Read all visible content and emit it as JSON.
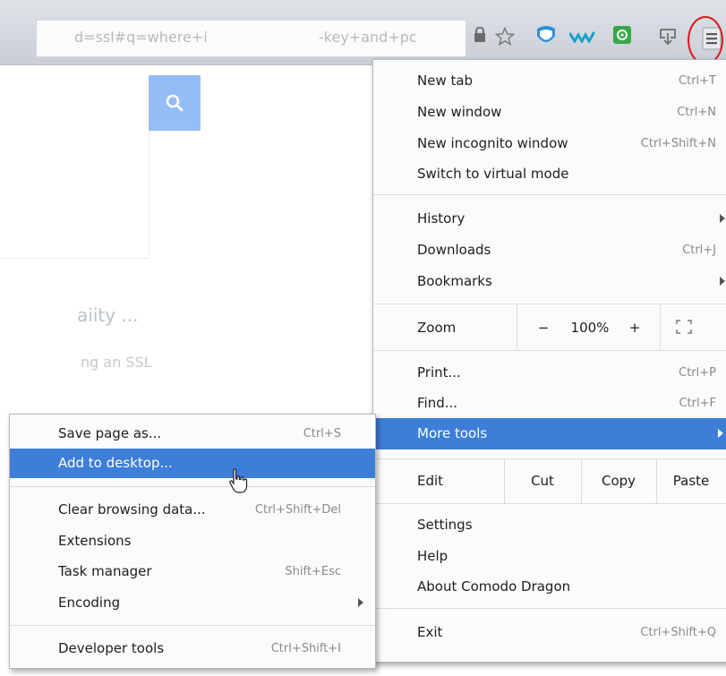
{
  "toolbar": {
    "url_left": "d=ssl#q=where+i",
    "url_right": "-key+and+pc",
    "icons": [
      "lock-icon",
      "star-icon",
      "comodo-shield-icon",
      "extension-wave-icon",
      "extension-green-icon",
      "download-icon",
      "menu-icon"
    ],
    "highlight_color": "#e4141c"
  },
  "page": {
    "faded_text_1": "aiity ...",
    "faded_text_2": "ng an SSL"
  },
  "main_menu": {
    "new_tab": {
      "label": "New tab",
      "shortcut": "Ctrl+T"
    },
    "new_window": {
      "label": "New window",
      "shortcut": "Ctrl+N"
    },
    "new_incognito": {
      "label": "New incognito window",
      "shortcut": "Ctrl+Shift+N"
    },
    "virtual_mode": {
      "label": "Switch to virtual mode"
    },
    "history": {
      "label": "History"
    },
    "downloads": {
      "label": "Downloads",
      "shortcut": "Ctrl+J"
    },
    "bookmarks": {
      "label": "Bookmarks"
    },
    "zoom": {
      "label": "Zoom",
      "minus": "−",
      "value": "100%",
      "plus": "+"
    },
    "print": {
      "label": "Print...",
      "shortcut": "Ctrl+P"
    },
    "find": {
      "label": "Find...",
      "shortcut": "Ctrl+F"
    },
    "more_tools": {
      "label": "More tools"
    },
    "edit": {
      "label": "Edit",
      "cut": "Cut",
      "copy": "Copy",
      "paste": "Paste"
    },
    "settings": {
      "label": "Settings"
    },
    "help": {
      "label": "Help"
    },
    "about": {
      "label": "About Comodo Dragon"
    },
    "exit": {
      "label": "Exit",
      "shortcut": "Ctrl+Shift+Q"
    }
  },
  "sub_menu": {
    "save_page": {
      "label": "Save page as...",
      "shortcut": "Ctrl+S"
    },
    "add_desktop": {
      "label": "Add to desktop..."
    },
    "clear_data": {
      "label": "Clear browsing data...",
      "shortcut": "Ctrl+Shift+Del"
    },
    "extensions": {
      "label": "Extensions"
    },
    "task_manager": {
      "label": "Task manager",
      "shortcut": "Shift+Esc"
    },
    "encoding": {
      "label": "Encoding"
    },
    "dev_tools": {
      "label": "Developer tools",
      "shortcut": "Ctrl+Shift+I"
    }
  },
  "colors": {
    "accent": "#3d7ed9",
    "menu_bg": "#fbfbfb"
  }
}
